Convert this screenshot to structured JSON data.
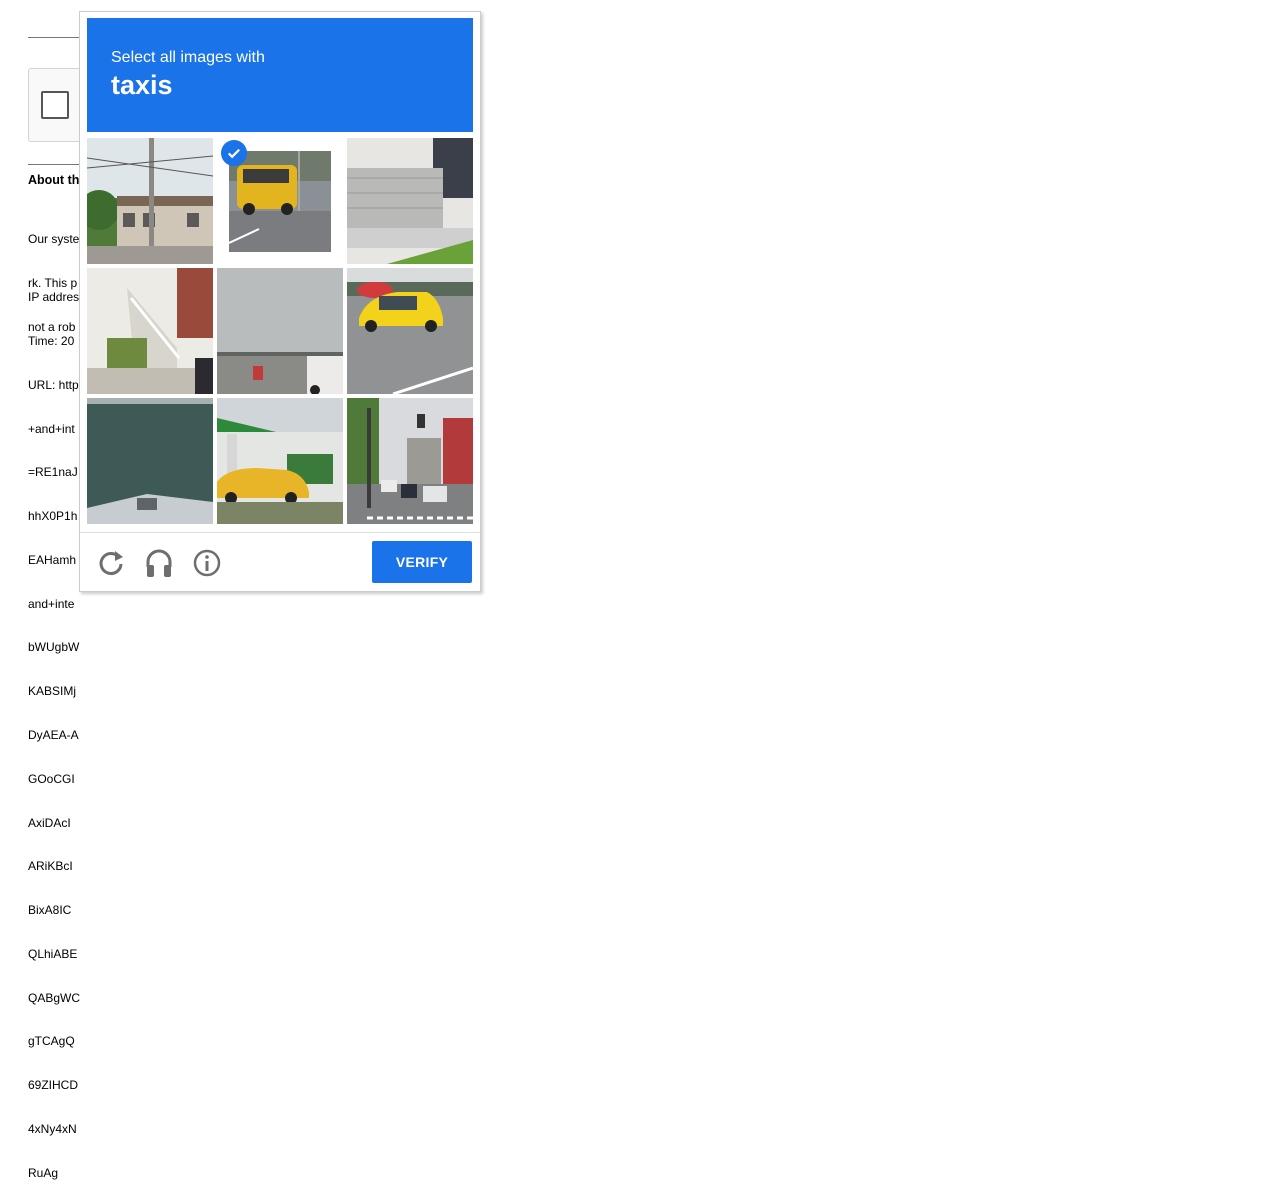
{
  "background": {
    "heading": "About th",
    "paragraph": [
      "Our syste",
      "rk. This p",
      "not a rob"
    ],
    "log_lines": [
      "IP addres",
      "Time: 20",
      "URL: http",
      "+and+int",
      "=RE1naJ",
      "hhX0P1h",
      "EAHamh",
      "and+inte",
      "bWUgbW",
      "KABSIMj",
      "DyAEA-A",
      "GOoCGI",
      "AxiDAcI",
      "ARiKBcI",
      "BixA8IC",
      "QLhiABE",
      "QABgWC",
      "gTCAgQ",
      "69ZIHCD",
      "4xNy4xN",
      "RuAg"
    ]
  },
  "challenge": {
    "prompt": "Select all images with",
    "object": "taxis",
    "header_color": "#1a73e8",
    "tiles": [
      {
        "label": "utility-pole-building",
        "selected": false
      },
      {
        "label": "yellow-taxi-van",
        "selected": true
      },
      {
        "label": "building-entrance",
        "selected": false
      },
      {
        "label": "house-stairs",
        "selected": false
      },
      {
        "label": "road-horizon",
        "selected": false
      },
      {
        "label": "yellow-taxi-road",
        "selected": false
      },
      {
        "label": "water-boat",
        "selected": false
      },
      {
        "label": "gas-station-taxi",
        "selected": false
      },
      {
        "label": "city-street-traffic",
        "selected": false
      }
    ],
    "footer": {
      "reload_icon": "reload-icon",
      "audio_icon": "headphones-icon",
      "info_icon": "info-icon",
      "verify_label": "VERIFY"
    }
  }
}
